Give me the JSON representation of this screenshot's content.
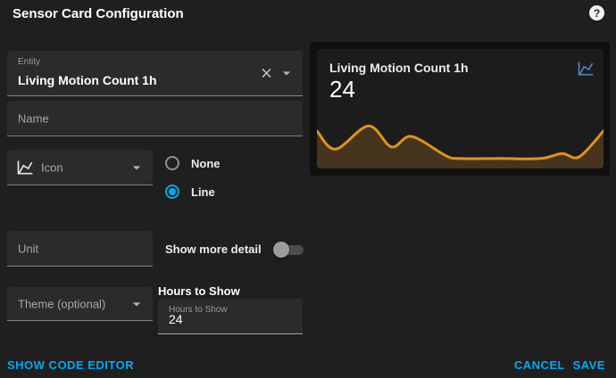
{
  "dialog": {
    "title": "Sensor Card Configuration",
    "help_icon": "help-circle"
  },
  "colors": {
    "background": "#1f1f1f",
    "field_background": "#2b2b2b",
    "accent_blue": "#03a9f4",
    "preview_icon_blue": "#4d84c4",
    "graph_line_orange": "#e0921f"
  },
  "form": {
    "entity": {
      "label": "Entity",
      "value": "Living Motion Count 1h",
      "clear_icon": "close",
      "dropdown_icon": "menu-down"
    },
    "name": {
      "placeholder": "Name",
      "value": ""
    },
    "icon": {
      "placeholder": "Icon",
      "leading_icon": "chart-line",
      "dropdown_icon": "menu-down"
    },
    "graph_type": {
      "options": [
        {
          "label": "None",
          "selected": false
        },
        {
          "label": "Line",
          "selected": true
        }
      ]
    },
    "unit": {
      "placeholder": "Unit",
      "value": ""
    },
    "show_more_detail": {
      "label": "Show more detail",
      "value": false
    },
    "theme": {
      "placeholder": "Theme (optional)",
      "dropdown_icon": "menu-down"
    },
    "hours_to_show": {
      "heading": "Hours to Show",
      "label": "Hours to Show",
      "value": "24"
    }
  },
  "preview": {
    "card": {
      "title": "Living Motion Count 1h",
      "value": "24",
      "icon": "chart-line"
    }
  },
  "chart_data": {
    "type": "area",
    "title": "Living Motion Count 1h sparkline (24h history, no axes shown)",
    "current_value": 24,
    "line_color": "#e0921f",
    "fill_opacity": 0.22,
    "points": [
      [
        0.0,
        0.68
      ],
      [
        0.065,
        0.35
      ],
      [
        0.18,
        0.77
      ],
      [
        0.26,
        0.39
      ],
      [
        0.33,
        0.58
      ],
      [
        0.45,
        0.23
      ],
      [
        0.5,
        0.18
      ],
      [
        0.64,
        0.18
      ],
      [
        0.78,
        0.18
      ],
      [
        0.855,
        0.27
      ],
      [
        0.915,
        0.21
      ],
      [
        1.0,
        0.68
      ]
    ]
  },
  "footer": {
    "show_code_editor": "SHOW CODE EDITOR",
    "cancel": "CANCEL",
    "save": "SAVE"
  }
}
